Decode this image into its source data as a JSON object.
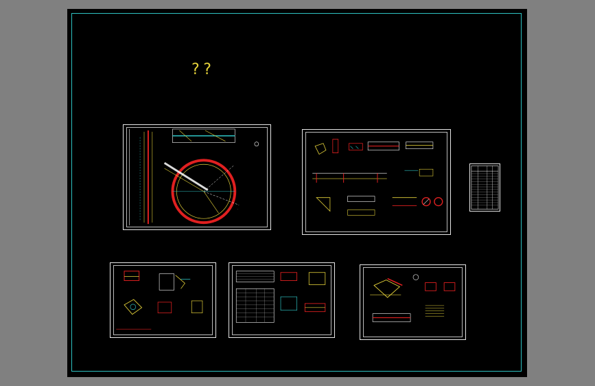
{
  "drawing": {
    "title": "??"
  },
  "colors": {
    "canvas": "#000000",
    "outside": "#808080",
    "frame": "#2ec4c4",
    "sheet_border": "#e8e8e8",
    "title_text": "#e6d33a",
    "geometry_red": "#e02020",
    "geometry_yellow": "#e6d33a",
    "geometry_cyan": "#2ec4c4",
    "geometry_white": "#ffffff"
  },
  "sheets": [
    {
      "id": "plan",
      "content": "circular-tank-plan-and-section"
    },
    {
      "id": "details-a",
      "content": "detail-drawings"
    },
    {
      "id": "table-panel",
      "content": "material-table"
    },
    {
      "id": "nodes-a",
      "content": "node-details"
    },
    {
      "id": "schedule",
      "content": "schedule-and-details"
    },
    {
      "id": "nodes-b",
      "content": "node-details"
    }
  ]
}
